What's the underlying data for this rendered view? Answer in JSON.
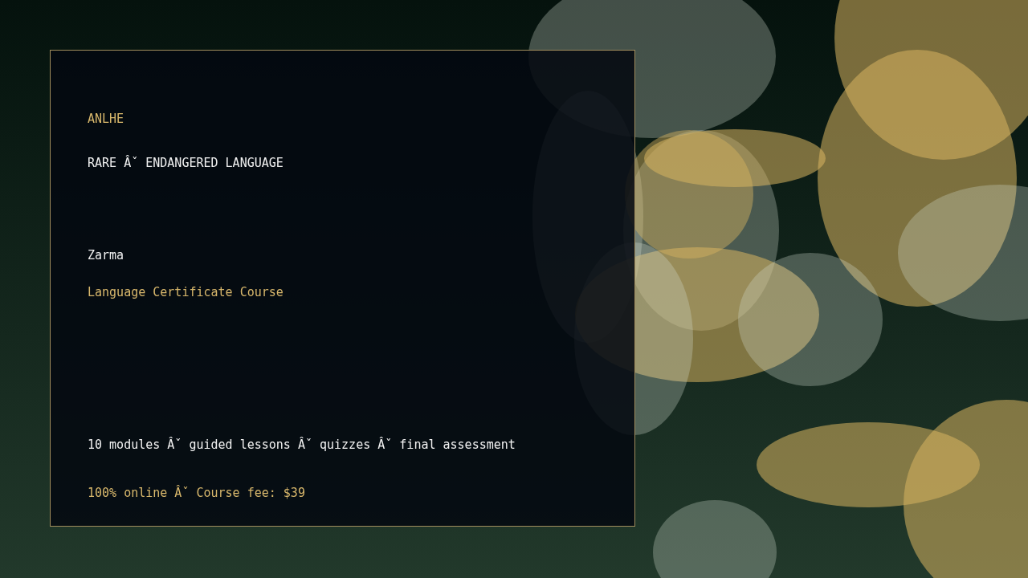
{
  "card": {
    "eyebrow": "ANLHE",
    "category": "RARE Âˇ ENDANGERED LANGUAGE",
    "language": "Zarma",
    "course": "Language Certificate Course",
    "details": "10 modules Âˇ guided lessons Âˇ quizzes Âˇ final assessment",
    "pricing": "100% online Âˇ Course fee: $39"
  }
}
